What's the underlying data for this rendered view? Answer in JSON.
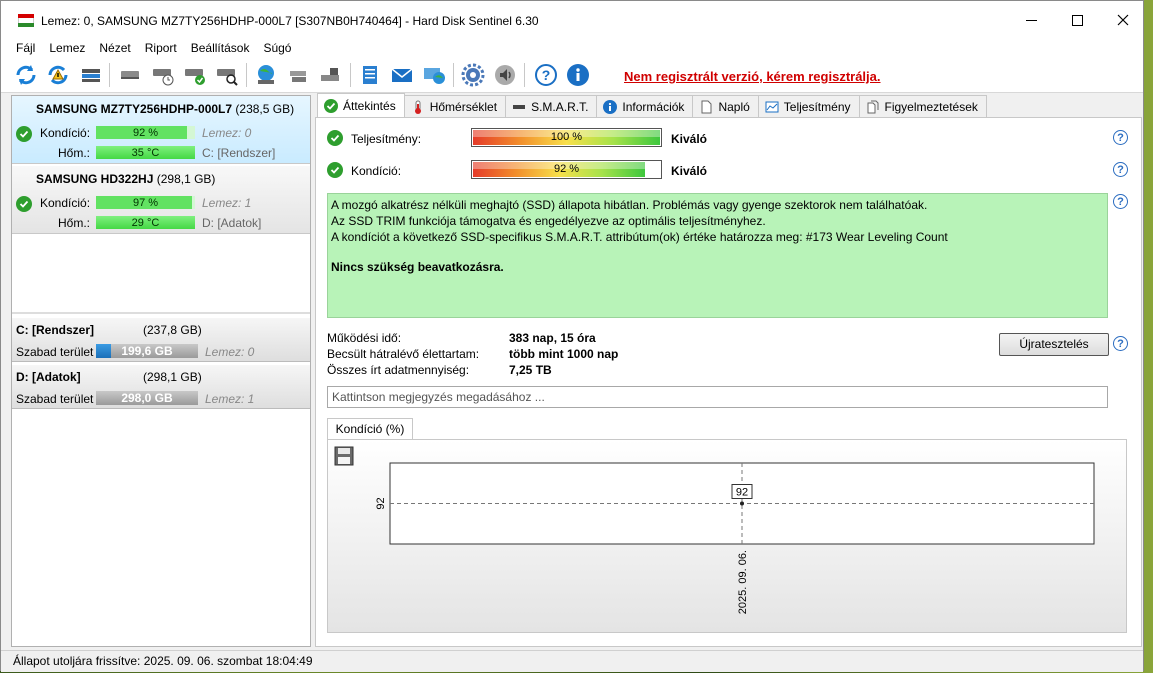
{
  "window": {
    "title": "Lemez: 0, SAMSUNG MZ7TY256HDHP-000L7 [S307NB0H740464]  -  Hard Disk Sentinel 6.30"
  },
  "menu": [
    "Fájl",
    "Lemez",
    "Nézet",
    "Riport",
    "Beállítások",
    "Súgó"
  ],
  "toolbar": {
    "unregistered_notice": "Nem regisztrált verzió, kérem regisztrálja."
  },
  "disks": [
    {
      "name": "SAMSUNG MZ7TY256HDHP-000L7",
      "size": "(238,5 GB)",
      "condition_label": "Kondíció:",
      "condition": "92 %",
      "condition_value": 92,
      "disk_ref": "Lemez: 0",
      "temp_label": "Hőm.:",
      "temp": "35 °C",
      "volume_ref": "C: [Rendszer]"
    },
    {
      "name": "SAMSUNG HD322HJ",
      "size": "(298,1 GB)",
      "condition_label": "Kondíció:",
      "condition": "97 %",
      "condition_value": 97,
      "disk_ref": "Lemez: 1",
      "temp_label": "Hőm.:",
      "temp": "29 °C",
      "volume_ref": "D: [Adatok]"
    }
  ],
  "volumes": [
    {
      "name": "C: [Rendszer]",
      "size": "(237,8 GB)",
      "free_label": "Szabad terület",
      "free": "199,6 GB",
      "disk_ref": "Lemez: 0"
    },
    {
      "name": "D: [Adatok]",
      "size": "(298,1 GB)",
      "free_label": "Szabad terület",
      "free": "298,0 GB",
      "disk_ref": "Lemez: 1"
    }
  ],
  "tabs": [
    "Áttekintés",
    "Hőmérséklet",
    "S.M.A.R.T.",
    "Információk",
    "Napló",
    "Teljesítmény",
    "Figyelmeztetések"
  ],
  "overview": {
    "performance_label": "Teljesítmény:",
    "performance_text": "100 %",
    "performance_value": 100,
    "performance_rating": "Kiváló",
    "condition_label": "Kondíció:",
    "condition_text": "92 %",
    "condition_value": 92,
    "condition_rating": "Kiváló",
    "summary_lines": [
      "A mozgó alkatrész nélküli meghajtó (SSD) állapota hibátlan. Problémás vagy gyenge szektorok nem találhatóak.",
      "Az SSD TRIM funkciója támogatva és engedélyezve az optimális teljesítményhez.",
      "A kondíciót a következő SSD-specifikus S.M.A.R.T. attribútum(ok) értéke határozza meg:  #173 Wear Leveling Count"
    ],
    "summary_action": "Nincs szükség beavatkozásra.",
    "uptime_label": "Működési idő:",
    "uptime": "383 nap, 15 óra",
    "lifetime_label": "Becsült hátralévő élettartam:",
    "lifetime": "több mint 1000 nap",
    "written_label": "Összes írt adatmennyiség:",
    "written": "7,25 TB",
    "reset_button": "Újratesztelés",
    "note_placeholder": "Kattintson megjegyzés megadásához ...",
    "chart_tab": "Kondíció  (%)"
  },
  "chart_data": {
    "type": "line",
    "title": "",
    "x": [
      "2025. 09. 06."
    ],
    "values": [
      92
    ],
    "ylabel_tick": "92",
    "point_label": "92",
    "xtick": "2025. 09. 06."
  },
  "statusbar": {
    "text": "Állapot utoljára frissítve: 2025. 09. 06. szombat 18:04:49"
  },
  "colors": {
    "accent_green": "#2e9e2e",
    "summary_bg": "#b8f3b8",
    "warning_red": "#d00000",
    "selected_card": "#c9ebff"
  }
}
